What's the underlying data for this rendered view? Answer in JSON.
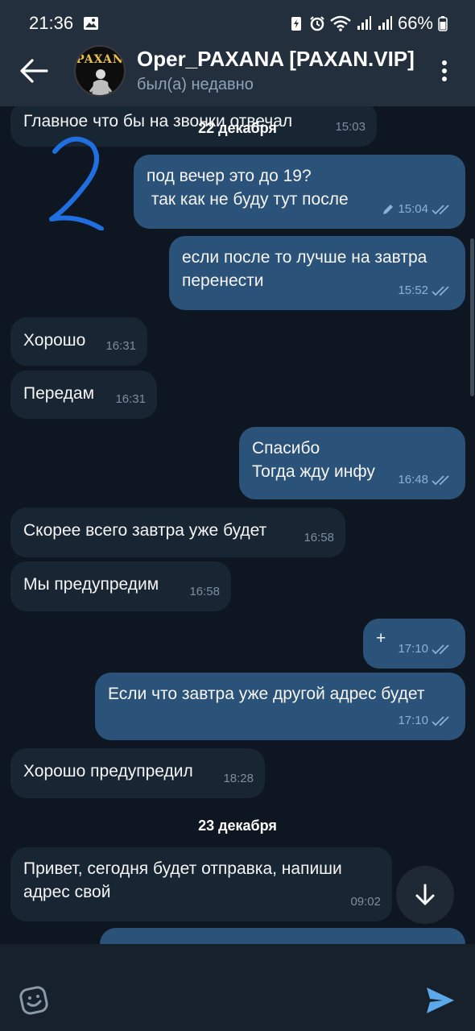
{
  "status_bar": {
    "time": "21:36",
    "battery": "66%"
  },
  "header": {
    "title": "Oper_PAXANA [PAXAN.VIP]",
    "subtitle": "был(а) недавно",
    "avatar_text": "PAXAN"
  },
  "chat": {
    "date_separators": [
      "22 декабря",
      "23 декабря"
    ],
    "messages": [
      {
        "direction": "in",
        "text": "Главное что бы на звонки отвечал",
        "time": "15:03"
      },
      {
        "direction": "out",
        "text": "под вечер это до 19?\n так как не буду тут после",
        "time": "15:04",
        "edited": true
      },
      {
        "direction": "out",
        "text": "если после то лучше на завтра\nперенести",
        "time": "15:52"
      },
      {
        "direction": "in",
        "text": "Хорошо",
        "time": "16:31"
      },
      {
        "direction": "in",
        "text": "Передам",
        "time": "16:31"
      },
      {
        "direction": "out",
        "text": "Спасибо\nТогда жду инфу",
        "time": "16:48"
      },
      {
        "direction": "in",
        "text": "Скорее всего завтра уже будет",
        "time": "16:58"
      },
      {
        "direction": "in",
        "text": "Мы предупредим",
        "time": "16:58"
      },
      {
        "direction": "out",
        "text": "+",
        "time": "17:10"
      },
      {
        "direction": "out",
        "text": "Если что завтра уже другой адрес будет",
        "time": "17:10"
      },
      {
        "direction": "in",
        "text": "Хорошо предупредил",
        "time": "18:28"
      },
      {
        "direction": "in",
        "text": "Привет, сегодня будет отправка, напиши\nадрес свой",
        "time": "09:02"
      }
    ]
  },
  "icons": {
    "back": "arrow-left-icon",
    "more": "more-vert-icon",
    "scroll_down": "arrow-down-icon",
    "emoji": "sticker-emoji-icon",
    "send": "send-icon"
  },
  "colors": {
    "incoming_bubble": "#182533",
    "outgoing_bubble": "#2b5278",
    "background": "#0e1621",
    "accent": "#5ca8e9"
  }
}
